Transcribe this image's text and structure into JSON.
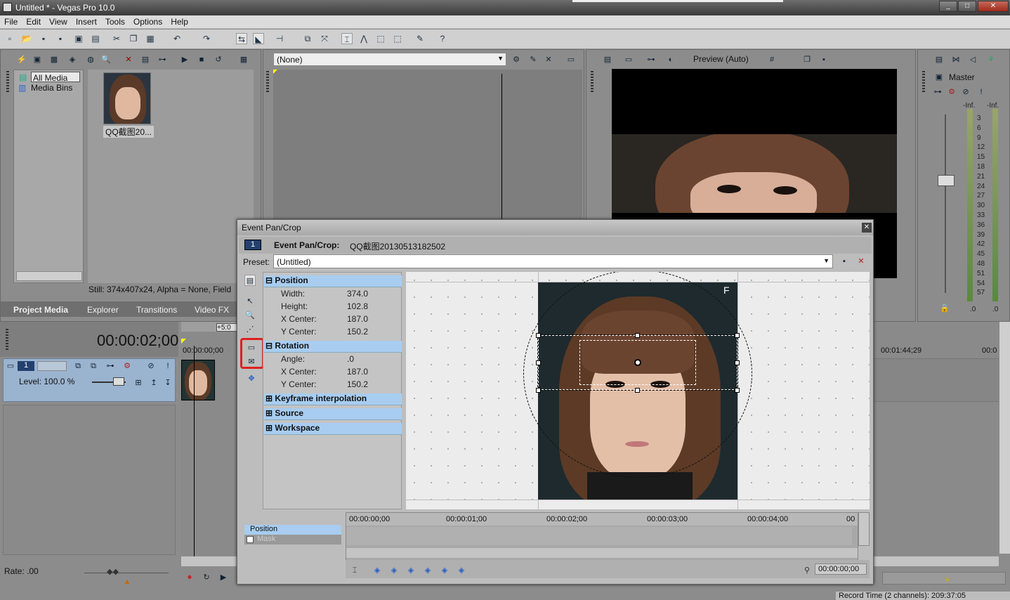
{
  "window": {
    "title": "Untitled * - Vegas Pro 10.0",
    "min": "_",
    "max": "□",
    "close": "✕"
  },
  "menu": [
    "File",
    "Edit",
    "View",
    "Insert",
    "Tools",
    "Options",
    "Help"
  ],
  "explorer": {
    "tree": [
      "All Media",
      "Media Bins"
    ],
    "thumb_label": "QQ截图20...",
    "status": "Still: 374x407x24, Alpha = None, Field",
    "tabs": [
      "Project Media",
      "Explorer",
      "Transitions",
      "Video FX"
    ]
  },
  "trimmer": {
    "dropdown": "(None)"
  },
  "preview": {
    "mode": "Preview (Auto)"
  },
  "mixer": {
    "name": "Master",
    "left_inf": "-Inf.",
    "right_inf": "-Inf.",
    "left_zero": ".0",
    "right_zero": ".0",
    "scale": [
      "3",
      "6",
      "9",
      "12",
      "15",
      "18",
      "21",
      "24",
      "27",
      "30",
      "33",
      "36",
      "39",
      "42",
      "45",
      "48",
      "51",
      "54",
      "57"
    ]
  },
  "timeline": {
    "time": "00:00:02;00",
    "ruler_start": "00:00:00;00",
    "ruler_end": "00:01:44;29",
    "ruler_end2": "00:0",
    "offset": "+5:0",
    "track_number": "1",
    "level": "Level: 100.0 %",
    "rate": "Rate: .00",
    "record_time": "Record Time (2 channels): 209:37:05"
  },
  "dialog": {
    "title": "Event Pan/Crop",
    "close": "✕",
    "number": "1",
    "heading_bold": "Event Pan/Crop:",
    "heading_name": "QQ截图20130513182502",
    "preset_label": "Preset:",
    "preset_value": "(Untitled)",
    "groups": [
      {
        "name": "Position",
        "rows": [
          {
            "label": "Width:",
            "value": "374.0"
          },
          {
            "label": "Height:",
            "value": "102.8"
          },
          {
            "label": "X Center:",
            "value": "187.0"
          },
          {
            "label": "Y Center:",
            "value": "150.2"
          }
        ]
      },
      {
        "name": "Rotation",
        "rows": [
          {
            "label": "Angle:",
            "value": ".0"
          },
          {
            "label": "X Center:",
            "value": "187.0"
          },
          {
            "label": "Y Center:",
            "value": "150.2"
          }
        ]
      }
    ],
    "collapsed": [
      "Keyframe interpolation",
      "Source",
      "Workspace"
    ],
    "keyframe_tracks": [
      "Position",
      "Mask"
    ],
    "ruler": [
      "00:00:00;00",
      "00:00:01;00",
      "00:00:02;00",
      "00:00:03;00",
      "00:00:04;00",
      "00"
    ],
    "cursor_time": "00:00:00;00"
  },
  "colors": {
    "accent": "#a8cdf0",
    "highlight_box": "#e02020",
    "track_selected": "#9ab3cf"
  }
}
